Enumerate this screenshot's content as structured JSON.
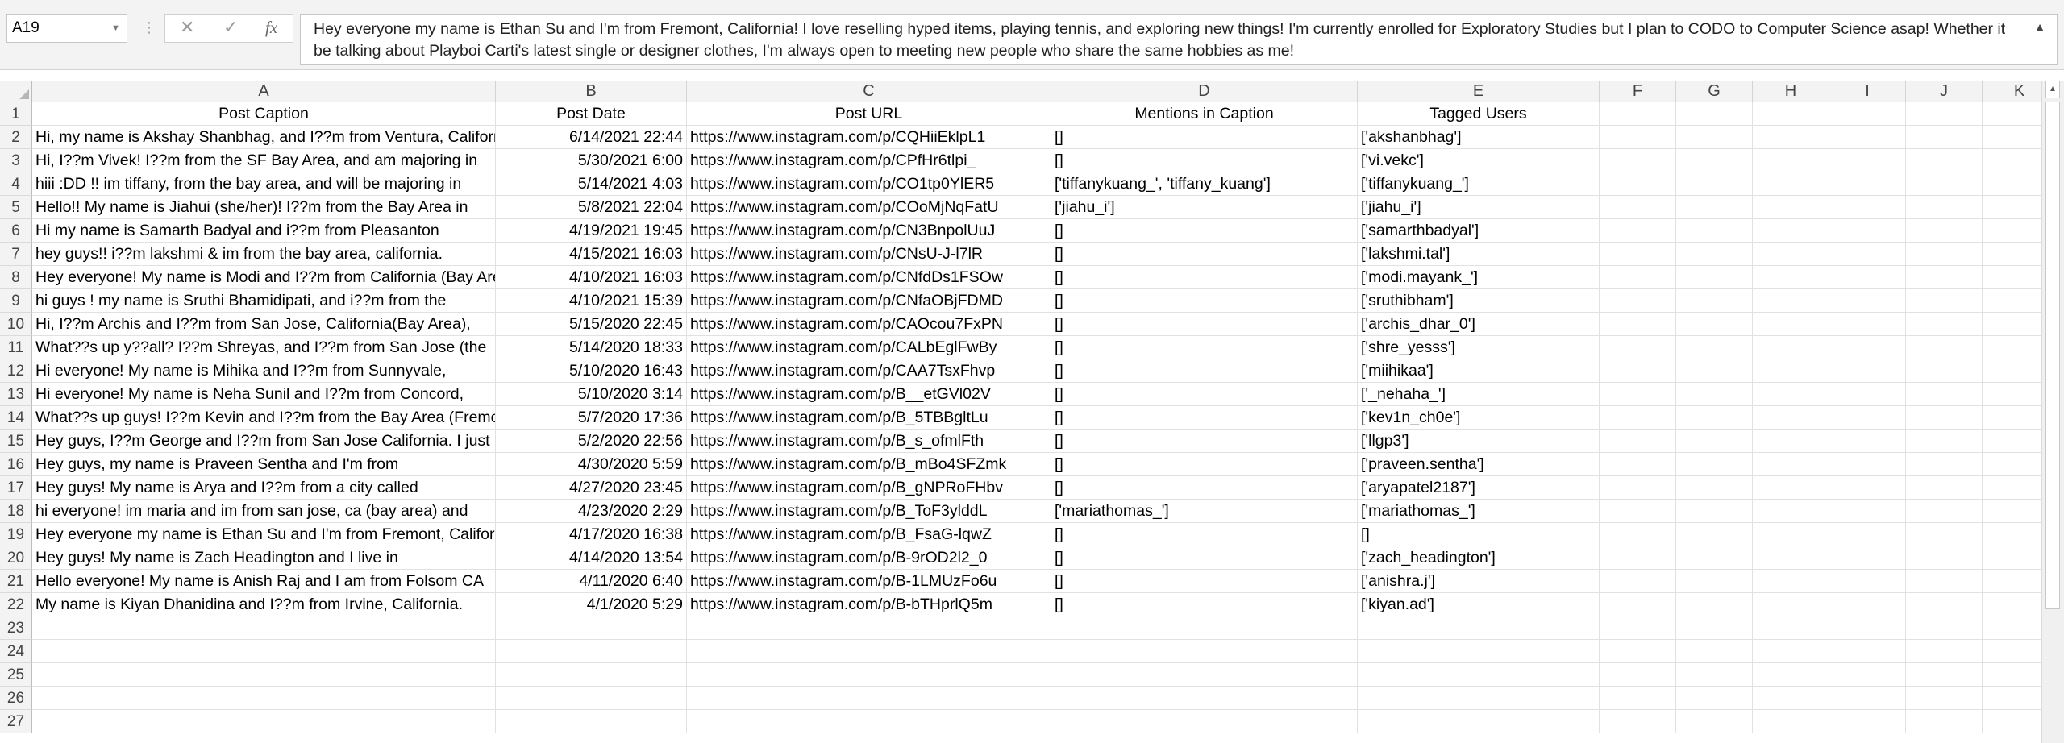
{
  "formula_bar": {
    "name_box": "A19",
    "formula_text": "Hey everyone my name is Ethan Su and I'm from Fremont, California! I love reselling hyped items, playing tennis, and exploring new things! I'm currently enrolled for Exploratory Studies but I plan to CODO to Computer Science asap! Whether it be talking about Playboi Carti's latest single or designer clothes, I'm always open to meeting new people who share the same hobbies as me!"
  },
  "columns": [
    "A",
    "B",
    "C",
    "D",
    "E",
    "F",
    "G",
    "H",
    "I",
    "J",
    "K"
  ],
  "header_row": {
    "A": "Post Caption",
    "B": "Post Date",
    "C": "Post URL",
    "D": "Mentions in Caption",
    "E": "Tagged Users"
  },
  "rows": [
    {
      "n": "2",
      "a": "Hi, my name is Akshay Shanbhag, and I??m from Ventura, California",
      "b": "6/14/2021 22:44",
      "c": "https://www.instagram.com/p/CQHiiEklpL1",
      "d": "[]",
      "e": "['akshanbhag']"
    },
    {
      "n": "3",
      "a": "Hi, I??m Vivek! I??m from the SF Bay Area, and am majoring in",
      "b": "5/30/2021 6:00",
      "c": "https://www.instagram.com/p/CPfHr6tlpi_",
      "d": "[]",
      "e": "['vi.vekc']"
    },
    {
      "n": "4",
      "a": "hiii :DD !! im tiffany, from the bay area, and will be majoring in",
      "b": "5/14/2021 4:03",
      "c": "https://www.instagram.com/p/CO1tp0YlER5",
      "d": "['tiffanykuang_', 'tiffany_kuang']",
      "e": "['tiffanykuang_']"
    },
    {
      "n": "5",
      "a": "Hello!! My name is Jiahui (she/her)! I??m from the Bay Area in",
      "b": "5/8/2021 22:04",
      "c": "https://www.instagram.com/p/COoMjNqFatU",
      "d": "['jiahu_i']",
      "e": "['jiahu_i']"
    },
    {
      "n": "6",
      "a": "Hi my name is Samarth Badyal and i??m from Pleasanton",
      "b": "4/19/2021 19:45",
      "c": "https://www.instagram.com/p/CN3BnpolUuJ",
      "d": "[]",
      "e": "['samarthbadyal']"
    },
    {
      "n": "7",
      "a": "hey guys!! i??m lakshmi & im from the bay area, california.",
      "b": "4/15/2021 16:03",
      "c": "https://www.instagram.com/p/CNsU-J-l7lR",
      "d": "[]",
      "e": "['lakshmi.tal']"
    },
    {
      "n": "8",
      "a": "Hey everyone! My name is Modi and I??m from California (Bay Area)",
      "b": "4/10/2021 16:03",
      "c": "https://www.instagram.com/p/CNfdDs1FSOw",
      "d": "[]",
      "e": "['modi.mayank_']"
    },
    {
      "n": "9",
      "a": "hi guys ! my name is Sruthi Bhamidipati, and i??m from the",
      "b": "4/10/2021 15:39",
      "c": "https://www.instagram.com/p/CNfaOBjFDMD",
      "d": "[]",
      "e": "['sruthibham']"
    },
    {
      "n": "10",
      "a": "Hi, I??m Archis and I??m from San Jose, California(Bay Area),",
      "b": "5/15/2020 22:45",
      "c": "https://www.instagram.com/p/CAOcou7FxPN",
      "d": "[]",
      "e": "['archis_dhar_0']"
    },
    {
      "n": "11",
      "a": "What??s up y??all? I??m Shreyas, and I??m from San Jose (the",
      "b": "5/14/2020 18:33",
      "c": "https://www.instagram.com/p/CALbEglFwBy",
      "d": "[]",
      "e": "['shre_yesss']"
    },
    {
      "n": "12",
      "a": "Hi everyone! My name is Mihika and I??m from Sunnyvale,",
      "b": "5/10/2020 16:43",
      "c": "https://www.instagram.com/p/CAA7TsxFhvp",
      "d": "[]",
      "e": "['miihikaa']"
    },
    {
      "n": "13",
      "a": "Hi everyone! My name is Neha Sunil and I??m from Concord,",
      "b": "5/10/2020 3:14",
      "c": "https://www.instagram.com/p/B__etGVl02V",
      "d": "[]",
      "e": "['_nehaha_']"
    },
    {
      "n": "14",
      "a": "What??s up guys! I??m Kevin and I??m from the Bay Area (Fremont)",
      "b": "5/7/2020 17:36",
      "c": "https://www.instagram.com/p/B_5TBBgltLu",
      "d": "[]",
      "e": "['kev1n_ch0e']"
    },
    {
      "n": "15",
      "a": "Hey guys, I??m George and I??m from San Jose California. I just",
      "b": "5/2/2020 22:56",
      "c": "https://www.instagram.com/p/B_s_ofmlFth",
      "d": "[]",
      "e": "['llgp3']"
    },
    {
      "n": "16",
      "a": "Hey guys, my name is Praveen Sentha and I'm from",
      "b": "4/30/2020 5:59",
      "c": "https://www.instagram.com/p/B_mBo4SFZmk",
      "d": "[]",
      "e": "['praveen.sentha']"
    },
    {
      "n": "17",
      "a": "Hey guys! My name is Arya and I??m from a city called",
      "b": "4/27/2020 23:45",
      "c": "https://www.instagram.com/p/B_gNPRoFHbv",
      "d": "[]",
      "e": "['aryapatel2187']"
    },
    {
      "n": "18",
      "a": "hi everyone! im maria and im from san jose, ca (bay area) and",
      "b": "4/23/2020 2:29",
      "c": "https://www.instagram.com/p/B_ToF3ylddL",
      "d": "['mariathomas_']",
      "e": "['mariathomas_']"
    },
    {
      "n": "19",
      "a": "Hey everyone my name is Ethan Su and I'm from Fremont, California!",
      "b": "4/17/2020 16:38",
      "c": "https://www.instagram.com/p/B_FsaG-lqwZ",
      "d": "[]",
      "e": "[]"
    },
    {
      "n": "20",
      "a": "Hey guys! My name is Zach Headington and I live in",
      "b": "4/14/2020 13:54",
      "c": "https://www.instagram.com/p/B-9rOD2l2_0",
      "d": "[]",
      "e": "['zach_headington']"
    },
    {
      "n": "21",
      "a": "Hello everyone! My name is Anish Raj and I am from Folsom CA",
      "b": "4/11/2020 6:40",
      "c": "https://www.instagram.com/p/B-1LMUzFo6u",
      "d": "[]",
      "e": "['anishra.j']"
    },
    {
      "n": "22",
      "a": "My name is Kiyan Dhanidina and I??m from Irvine, California.",
      "b": "4/1/2020 5:29",
      "c": "https://www.instagram.com/p/B-bTHprlQ5m",
      "d": "[]",
      "e": "['kiyan.ad']"
    }
  ],
  "empty_rows": [
    "23",
    "24",
    "25",
    "26",
    "27"
  ],
  "header_row_number": "1"
}
